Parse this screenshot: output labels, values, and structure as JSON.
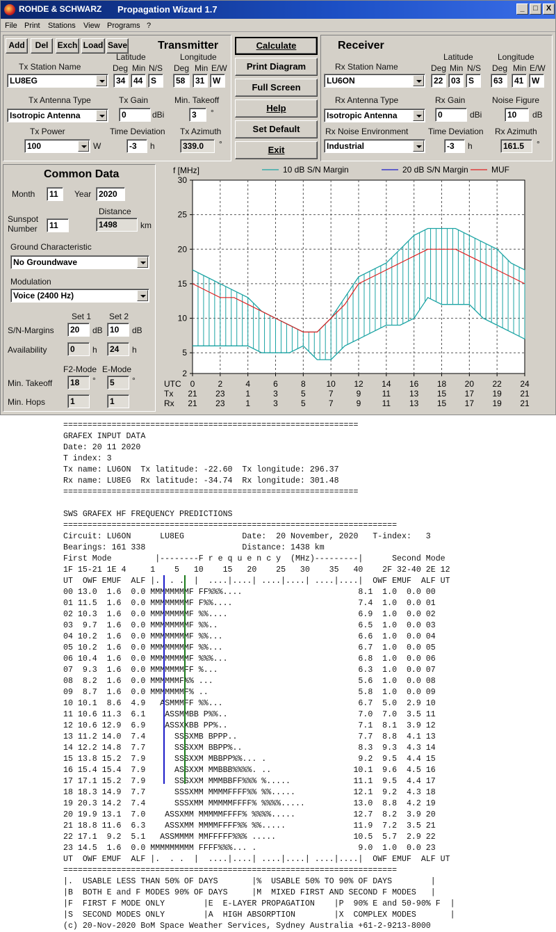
{
  "window": {
    "brand": "ROHDE & SCHWARZ",
    "title": "Propagation Wizard  1.7",
    "controls": {
      "minimize": "_",
      "maximize": "□",
      "close": "X"
    }
  },
  "menu": [
    "File",
    "Print",
    "Stations",
    "View",
    "Programs",
    "?"
  ],
  "toolbar": [
    "Add",
    "Del",
    "Exch",
    "Load",
    "Save"
  ],
  "transmitter": {
    "header": "Transmitter",
    "station_label": "Tx Station Name",
    "station": "LU8EG",
    "lat_label": "Latitude",
    "lon_label": "Longitude",
    "deg": "Deg",
    "min": "Min",
    "ns": "N/S",
    "ew": "E/W",
    "lat_deg": "34",
    "lat_min": "44",
    "lat_ns": "S",
    "lon_deg": "58",
    "lon_min": "31",
    "lon_ew": "W",
    "antenna_label": "Tx Antenna Type",
    "antenna": "Isotropic Antenna",
    "gain_label": "Tx Gain",
    "gain": "0",
    "gain_unit": "dBi",
    "takeoff_label": "Min. Takeoff",
    "takeoff": "3",
    "takeoff_unit": "°",
    "power_label": "Tx Power",
    "power": "100",
    "power_unit": "W",
    "timedev_label": "Time Deviation",
    "timedev": "-3",
    "timedev_unit": "h",
    "azimuth_label": "Tx Azimuth",
    "azimuth": "339.0",
    "azimuth_unit": "°"
  },
  "actions": [
    "Calculate",
    "Print Diagram",
    "Full Screen",
    "Help",
    "Set Default",
    "Exit"
  ],
  "receiver": {
    "header": "Receiver",
    "station_label": "Rx Station Name",
    "station": "LU6ON",
    "lat_label": "Latitude",
    "lon_label": "Longitude",
    "deg": "Deg",
    "min": "Min",
    "ns": "N/S",
    "ew": "E/W",
    "lat_deg": "22",
    "lat_min": "03",
    "lat_ns": "S",
    "lon_deg": "63",
    "lon_min": "41",
    "lon_ew": "W",
    "antenna_label": "Rx Antenna Type",
    "antenna": "Isotropic Antenna",
    "gain_label": "Rx Gain",
    "gain": "0",
    "gain_unit": "dBi",
    "noise_fig_label": "Noise Figure",
    "noise_fig": "10",
    "noise_fig_unit": "dB",
    "noise_env_label": "Rx Noise Environment",
    "noise_env": "Industrial",
    "timedev_label": "Time Deviation",
    "timedev": "-3",
    "timedev_unit": "h",
    "azimuth_label": "Rx Azimuth",
    "azimuth": "161.5",
    "azimuth_unit": "°"
  },
  "common": {
    "header": "Common Data",
    "month_label": "Month",
    "month": "11",
    "year_label": "Year",
    "year": "2020",
    "sunspot_label1": "Sunspot",
    "sunspot_label2": "Number",
    "sunspot": "11",
    "distance_label": "Distance",
    "distance": "1498",
    "distance_unit": "km",
    "ground_label": "Ground Characteristic",
    "ground": "No Groundwave",
    "modulation_label": "Modulation",
    "modulation": "Voice   (2400 Hz)",
    "set1_label": "Set 1",
    "set2_label": "Set 2",
    "sn_label": "S/N-Margins",
    "sn1": "20",
    "sn2": "10",
    "sn_unit": "dB",
    "avail_label": "Availability",
    "avail1": "0",
    "avail2": "24",
    "avail_unit": "h",
    "f2_label": "F2-Mode",
    "e_label": "E-Mode",
    "takeoff_label": "Min. Takeoff",
    "takeoff_f2": "18",
    "takeoff_e": "5",
    "takeoff_unit": "°",
    "hops_label": "Min. Hops",
    "hops_f2": "1",
    "hops_e": "1"
  },
  "chart_data": {
    "type": "line",
    "ylabel": "f [MHz]",
    "ylim": [
      2,
      30
    ],
    "yticks": [
      2,
      5,
      10,
      15,
      20,
      25,
      30
    ],
    "xlim": [
      0,
      24
    ],
    "x_row_labels": [
      "UTC",
      "Tx",
      "Rx"
    ],
    "utc_ticks": [
      "0",
      "2",
      "4",
      "6",
      "8",
      "10",
      "12",
      "14",
      "16",
      "18",
      "20",
      "22",
      "24"
    ],
    "tx_ticks": [
      "21",
      "23",
      "1",
      "3",
      "5",
      "7",
      "9",
      "11",
      "13",
      "15",
      "17",
      "19",
      "21"
    ],
    "rx_ticks": [
      "21",
      "23",
      "1",
      "3",
      "5",
      "7",
      "9",
      "11",
      "13",
      "15",
      "17",
      "19",
      "21"
    ],
    "grid": true,
    "legend_position": "top",
    "colors": {
      "band10": "#1aa3a3",
      "band20": "#1c1cc8",
      "muf": "#e02020"
    },
    "series": [
      {
        "name": "10 dB S/N Margin"
      },
      {
        "name": "20 dB S/N Margin"
      },
      {
        "name": "MUF"
      }
    ],
    "x": [
      0,
      1,
      2,
      3,
      4,
      5,
      6,
      7,
      8,
      9,
      10,
      11,
      12,
      13,
      14,
      15,
      16,
      17,
      18,
      19,
      20,
      21,
      22,
      23,
      24
    ],
    "band10_upper": [
      17,
      16,
      15,
      14,
      13,
      11,
      10,
      9,
      8,
      8,
      10,
      13,
      16,
      17,
      18,
      20,
      22,
      23,
      23,
      23,
      22,
      21,
      20,
      18,
      17
    ],
    "band10_lower": [
      6,
      6,
      6,
      6,
      6,
      5,
      5,
      5,
      6,
      4,
      4,
      6,
      7,
      8,
      9,
      9,
      10,
      13,
      12,
      12,
      12,
      10,
      9,
      8,
      7,
      6
    ],
    "muf": [
      15,
      14,
      13,
      13,
      12,
      11,
      10,
      9,
      8,
      8,
      10,
      12,
      15,
      16,
      17,
      18,
      19,
      20,
      20,
      20,
      19,
      18,
      17,
      16,
      15
    ]
  },
  "report": [
    "=============================================================",
    "GRAFEX INPUT DATA",
    "Date: 20 11 2020",
    "T index: 3",
    "Tx name: LU6ON  Tx latitude: -22.60  Tx longitude: 296.37",
    "Rx name: LU8EG  Rx latitude: -34.74  Rx longitude: 301.48",
    "=============================================================",
    "",
    "SWS GRAFEX HF FREQUENCY PREDICTIONS",
    "=====================================================================",
    "Circuit: LU6ON      LU8EG            Date:  20 November, 2020   T-index:   3",
    "Bearings: 161 338                    Distance: 1438 km",
    "First Mode         |--------F r e q u e n c y  (MHz)---------|      Second Mode",
    "1F 15-21 1E 4     1    5   10    15   20    25   30    35   40    2F 32-40 2E 12",
    "UT  OWF EMUF  ALF |.  . .  |  ....|....| ....|....| ....|....|  OWF EMUF  ALF UT",
    "00 13.0  1.6  0.0 MMMMMMMMF FF%%%....                        8.1  1.0  0.0 00",
    "01 11.5  1.6  0.0 MMMMMMMMF F%%....                          7.4  1.0  0.0 01",
    "02 10.3  1.6  0.0 MMMMMMMMF %%....                           6.9  1.0  0.0 02",
    "03  9.7  1.6  0.0 MMMMMMMMF %%..                             6.5  1.0  0.0 03",
    "04 10.2  1.6  0.0 MMMMMMMMF %%...                            6.6  1.0  0.0 04",
    "05 10.2  1.6  0.0 MMMMMMMMF %%...                            6.7  1.0  0.0 05",
    "06 10.4  1.6  0.0 MMMMMMMMF %%%...                           6.8  1.0  0.0 06",
    "07  9.3  1.6  0.0 MMMMMMMFF %...                             6.3  1.0  0.0 07",
    "08  8.2  1.6  0.0 MMMMMMF%% ...                              5.6  1.0  0.0 08",
    "09  8.7  1.6  0.0 MMMMMMMF% ..                               5.8  1.0  0.0 09",
    "10 10.1  8.6  4.9   ASMMMFF %%...                            6.7  5.0  2.9 10",
    "11 10.6 11.3  6.1    ASSMMBB P%%..                           7.0  7.0  3.5 11",
    "12 10.6 12.9  6.9    ASSXXBB PP%..                           7.1  8.1  3.9 12",
    "13 11.2 14.0  7.4      SSSXMB BPPP..                         7.7  8.8  4.1 13",
    "14 12.2 14.8  7.7      SSSXXM BBPP%..                        8.3  9.3  4.3 14",
    "15 13.8 15.2  7.9      SSSXXM MBBPP%%... .                   9.2  9.5  4.4 15",
    "16 15.4 15.4  7.9      ASSXXM MMBBB%%%%. ..                 10.1  9.6  4.5 16",
    "17 17.1 15.2  7.9      SSSXXM MMMBBFF%%% %.....             11.1  9.5  4.4 17",
    "18 18.3 14.9  7.7      SSSXMM MMMMFFFF%% %%.....            12.1  9.2  4.3 18",
    "19 20.3 14.2  7.4      SSSXMM MMMMMFFFF% %%%%.....          13.0  8.8  4.2 19",
    "20 19.9 13.1  7.0    ASSXMM MMMMMFFFF% %%%%.....            12.7  8.2  3.9 20",
    "21 18.8 11.6  6.3    ASSXMM MMMMFFFF%% %%.....              11.9  7.2  3.5 21",
    "22 17.1  9.2  5.1   ASSMMMM MMFFFFF%%% .....                10.5  5.7  2.9 22",
    "23 14.5  1.6  0.0 MMMMMMMMM FFFF%%%... .                     9.0  1.0  0.0 23",
    "UT  OWF EMUF  ALF |.  . .  |  ....|....| ....|....| ....|....|  OWF EMUF  ALF UT",
    "=====================================================================",
    "|.  USABLE LESS THAN 50% OF DAYS       |%  USABLE 50% TO 90% OF DAYS        |",
    "|B  BOTH E and F MODES 90% OF DAYS     |M  MIXED FIRST AND SECOND F MODES   |",
    "|F  FIRST F MODE ONLY        |E  E-LAYER PROPAGATION    |P  90% E and 50-90% F  |",
    "|S  SECOND MODES ONLY        |A  HIGH ABSORPTION        |X  COMPLEX MODES       |",
    "(c) 20-Nov-2020 BoM Space Weather Services, Sydney Australia +61-2-9213-8000"
  ]
}
